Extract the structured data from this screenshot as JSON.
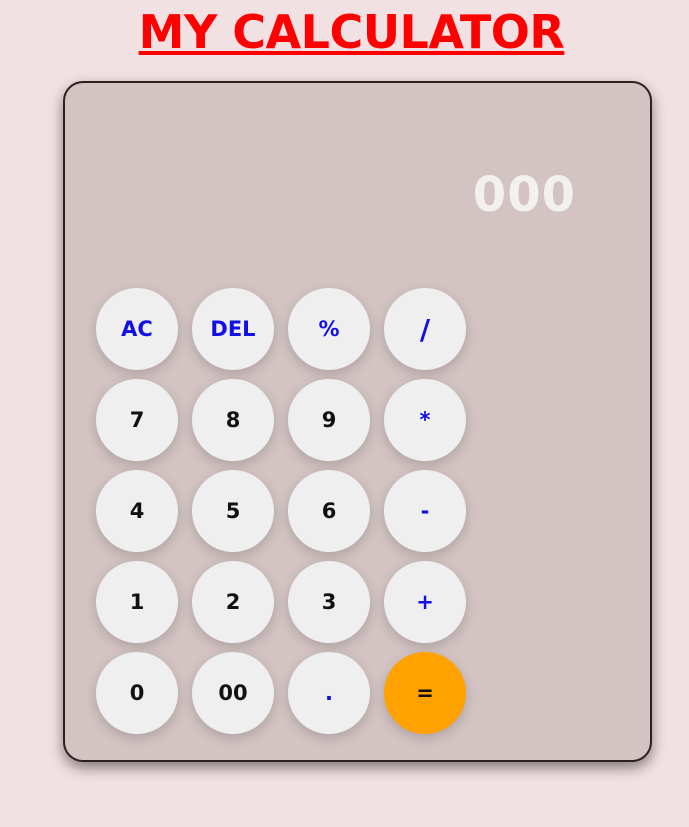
{
  "header": {
    "title": "MY CALCULATOR"
  },
  "display": {
    "value": "000"
  },
  "keys": [
    {
      "label": "AC",
      "name": "all-clear-button"
    },
    {
      "label": "DEL",
      "name": "delete-button"
    },
    {
      "label": "%",
      "name": "percent-button"
    },
    {
      "label": "/",
      "name": "divide-button"
    },
    {
      "label": "7",
      "name": "digit-7-button"
    },
    {
      "label": "8",
      "name": "digit-8-button"
    },
    {
      "label": "9",
      "name": "digit-9-button"
    },
    {
      "label": "*",
      "name": "multiply-button"
    },
    {
      "label": "4",
      "name": "digit-4-button"
    },
    {
      "label": "5",
      "name": "digit-5-button"
    },
    {
      "label": "6",
      "name": "digit-6-button"
    },
    {
      "label": "-",
      "name": "subtract-button"
    },
    {
      "label": "1",
      "name": "digit-1-button"
    },
    {
      "label": "2",
      "name": "digit-2-button"
    },
    {
      "label": "3",
      "name": "digit-3-button"
    },
    {
      "label": "+",
      "name": "add-button"
    },
    {
      "label": "0",
      "name": "digit-0-button"
    },
    {
      "label": "00",
      "name": "double-zero-button"
    },
    {
      "label": ".",
      "name": "decimal-button"
    },
    {
      "label": "=",
      "name": "equals-button"
    }
  ],
  "colors": {
    "background": "#f2e1e2",
    "title": "#ff0000",
    "panel": "#d3c4c3",
    "operator_text": "#1010e6",
    "equals_key": "#ffa200",
    "display_text": "#f3f0f0"
  }
}
